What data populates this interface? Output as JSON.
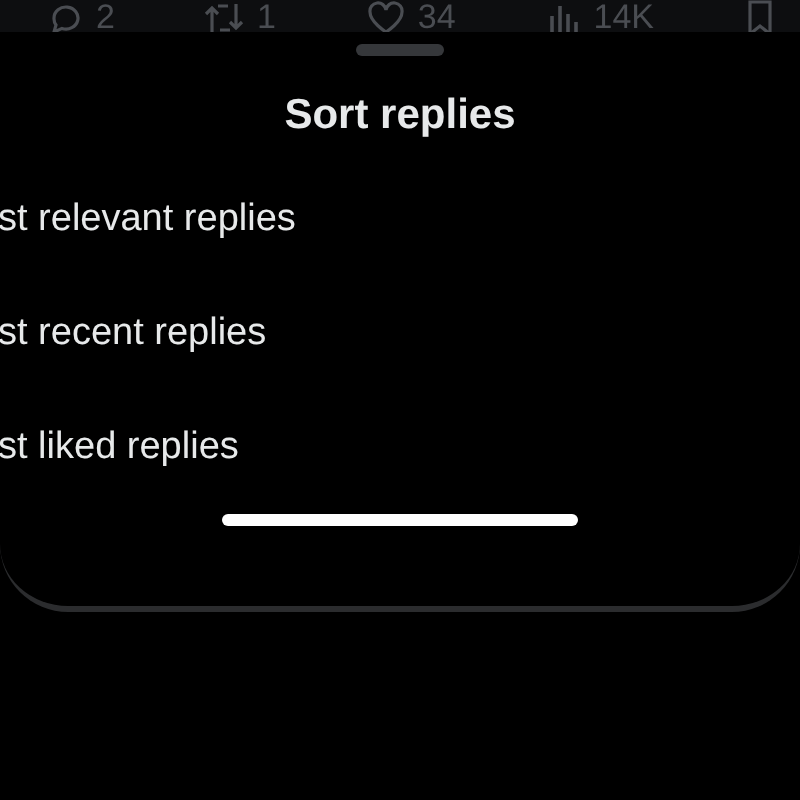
{
  "actions": [
    {
      "kind": "reply",
      "count": "2"
    },
    {
      "kind": "repost",
      "count": "1"
    },
    {
      "kind": "like",
      "count": "34"
    },
    {
      "kind": "views",
      "count": "14K"
    },
    {
      "kind": "bookmark"
    }
  ],
  "sheet": {
    "title": "Sort replies",
    "options": [
      "st relevant replies",
      "st recent replies",
      "st liked replies"
    ]
  }
}
